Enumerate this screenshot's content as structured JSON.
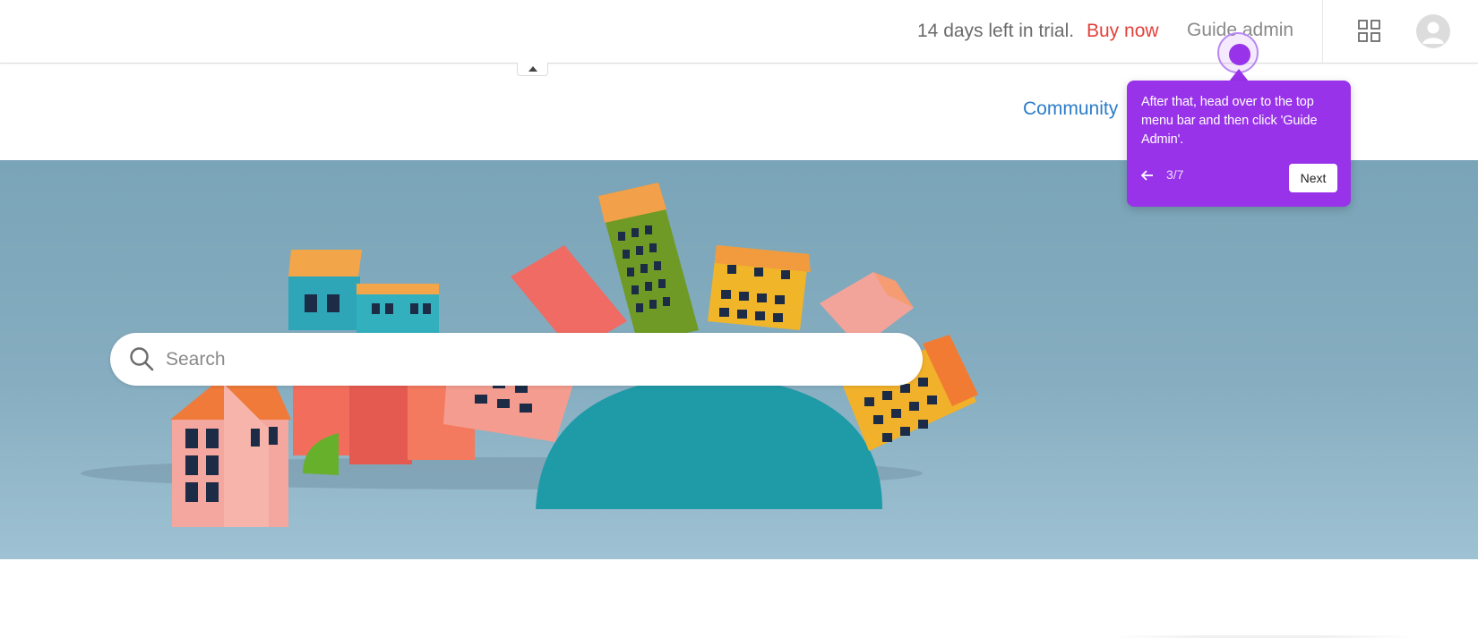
{
  "topbar": {
    "trial_text": "14 days left in trial.",
    "buy_now": "Buy now",
    "guide_admin": "Guide admin",
    "icons": {
      "apps": "grid-icon",
      "avatar": "user-icon",
      "collapse": "caret-up-icon"
    }
  },
  "nav": {
    "community": "Community"
  },
  "search": {
    "placeholder": "Search",
    "icon": "search-icon"
  },
  "guide_tooltip": {
    "text": "After that, head over to the top menu bar and then click 'Guide Admin'.",
    "progress": "3/7",
    "next_label": "Next",
    "back_icon": "arrow-left-icon"
  },
  "colors": {
    "accent_purple": "#9933ea",
    "buy_now_red": "#e2403a",
    "link_blue": "#2b7cc9",
    "hero_bg": "#7aa4b8"
  }
}
